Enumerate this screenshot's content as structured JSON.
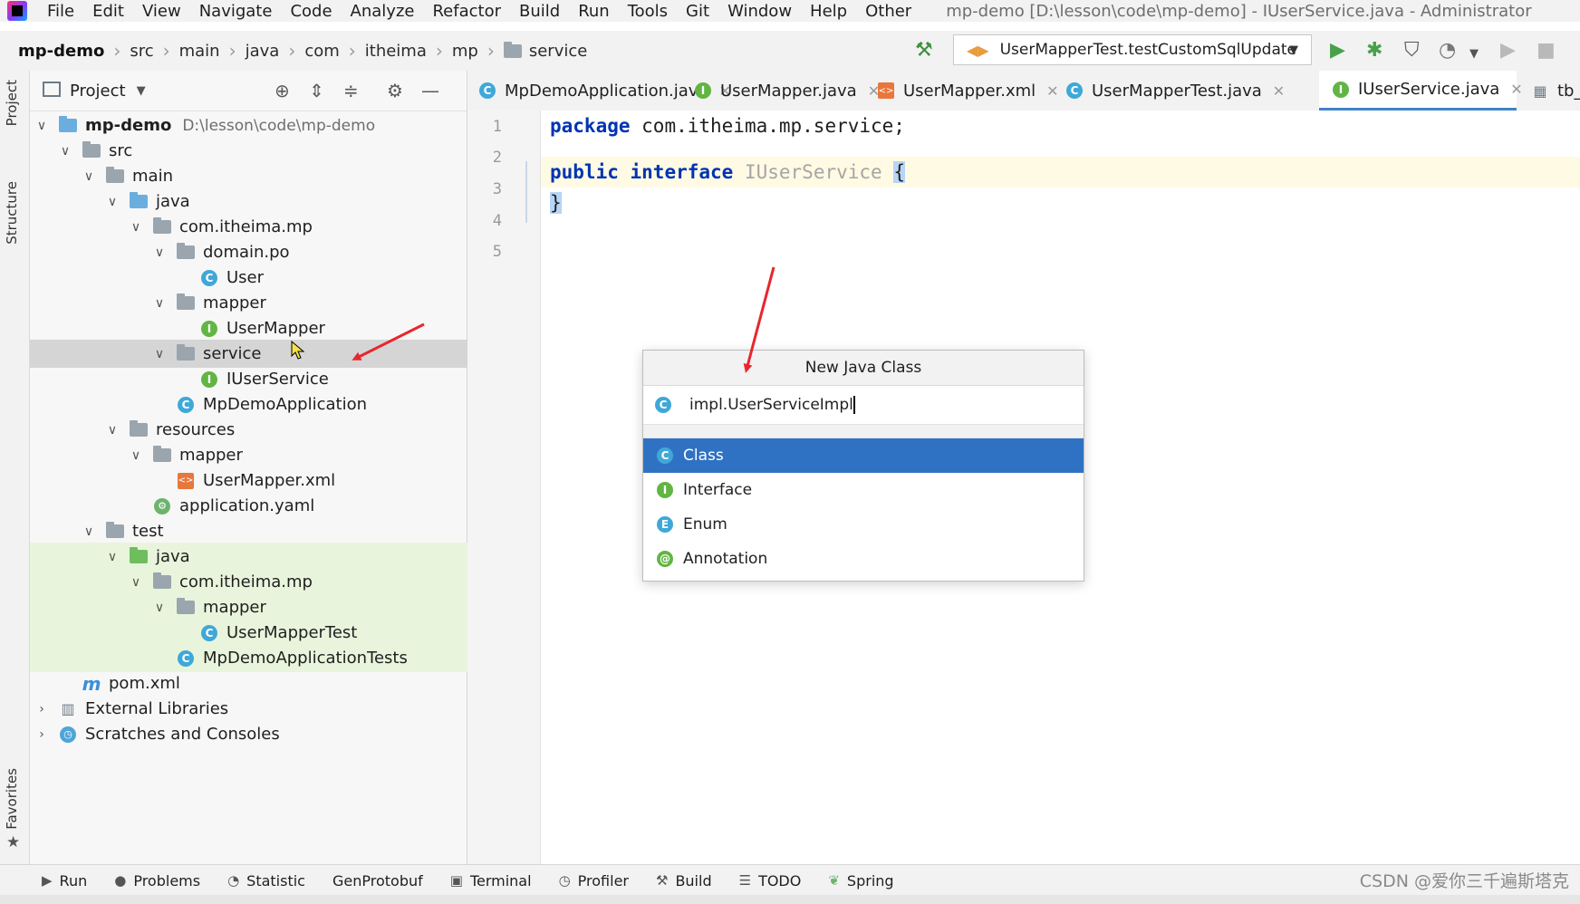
{
  "menu": [
    "File",
    "Edit",
    "View",
    "Navigate",
    "Code",
    "Analyze",
    "Refactor",
    "Build",
    "Run",
    "Tools",
    "Git",
    "Window",
    "Help",
    "Other"
  ],
  "window_title": "mp-demo [D:\\lesson\\code\\mp-demo] - IUserService.java - Administrator",
  "breadcrumb": [
    "mp-demo",
    "src",
    "main",
    "java",
    "com",
    "itheima",
    "mp",
    "service"
  ],
  "run_config": "UserMapperTest.testCustomSqlUpdate",
  "left_strip": {
    "project": "Project",
    "structure": "Structure",
    "favorites": "Favorites"
  },
  "project_panel": {
    "title": "Project",
    "tree": [
      {
        "label": "mp-demo",
        "hint": "D:\\lesson\\code\\mp-demo",
        "icon": "module-folder-icon"
      },
      {
        "label": "src",
        "icon": "folder-icon"
      },
      {
        "label": "main",
        "icon": "folder-icon"
      },
      {
        "label": "java",
        "icon": "source-folder-icon"
      },
      {
        "label": "com.itheima.mp",
        "icon": "package-icon"
      },
      {
        "label": "domain.po",
        "icon": "package-icon"
      },
      {
        "label": "User",
        "icon": "class-icon"
      },
      {
        "label": "mapper",
        "icon": "package-icon"
      },
      {
        "label": "UserMapper",
        "icon": "interface-icon"
      },
      {
        "label": "service",
        "icon": "package-icon"
      },
      {
        "label": "IUserService",
        "icon": "interface-icon"
      },
      {
        "label": "MpDemoApplication",
        "icon": "spring-class-icon"
      },
      {
        "label": "resources",
        "icon": "resources-folder-icon"
      },
      {
        "label": "mapper",
        "icon": "folder-icon"
      },
      {
        "label": "UserMapper.xml",
        "icon": "xml-file-icon"
      },
      {
        "label": "application.yaml",
        "icon": "yaml-file-icon"
      },
      {
        "label": "test",
        "icon": "folder-icon"
      },
      {
        "label": "java",
        "icon": "test-folder-icon"
      },
      {
        "label": "com.itheima.mp",
        "icon": "package-icon"
      },
      {
        "label": "mapper",
        "icon": "package-icon"
      },
      {
        "label": "UserMapperTest",
        "icon": "test-class-icon"
      },
      {
        "label": "MpDemoApplicationTests",
        "icon": "test-class-icon"
      },
      {
        "label": "pom.xml",
        "icon": "maven-icon"
      },
      {
        "label": "External Libraries",
        "icon": "libraries-icon"
      },
      {
        "label": "Scratches and Consoles",
        "icon": "scratches-icon"
      }
    ]
  },
  "editor_tabs": [
    {
      "label": "MpDemoApplication.java",
      "icon": "spring-class-icon"
    },
    {
      "label": "UserMapper.java",
      "icon": "interface-icon"
    },
    {
      "label": "UserMapper.xml",
      "icon": "xml-file-icon"
    },
    {
      "label": "UserMapperTest.java",
      "icon": "test-class-icon"
    },
    {
      "label": "IUserService.java",
      "icon": "interface-icon"
    },
    {
      "label": "tb_use",
      "icon": "table-icon"
    }
  ],
  "editor": {
    "line_numbers": [
      "1",
      "2",
      "3",
      "4",
      "5"
    ],
    "lines": {
      "l1_kw": "package",
      "l1_rest": " com.itheima.mp.service;",
      "l3_kw1": "public",
      "l3_kw2": "interface",
      "l3_type": "IUserService",
      "l3_brace": "{",
      "l4_brace": "}"
    }
  },
  "dialog": {
    "title": "New Java Class",
    "input_value": "impl.UserServiceImpl",
    "options": [
      {
        "label": "Class",
        "icon": "class-icon",
        "badge": "C"
      },
      {
        "label": "Interface",
        "icon": "interface-icon",
        "badge": "I"
      },
      {
        "label": "Enum",
        "icon": "enum-icon",
        "badge": "E"
      },
      {
        "label": "Annotation",
        "icon": "annotation-icon",
        "badge": "@"
      }
    ]
  },
  "bottom_bar": [
    "Run",
    "Problems",
    "Statistic",
    "GenProtobuf",
    "Terminal",
    "Profiler",
    "Build",
    "TODO",
    "Spring"
  ],
  "watermark": "CSDN @爱你三千遍斯塔克",
  "colors": {
    "selection": "#2f72c4",
    "accent": "#4083c9",
    "keyword": "#0033b3",
    "arrow": "#e8262d"
  }
}
